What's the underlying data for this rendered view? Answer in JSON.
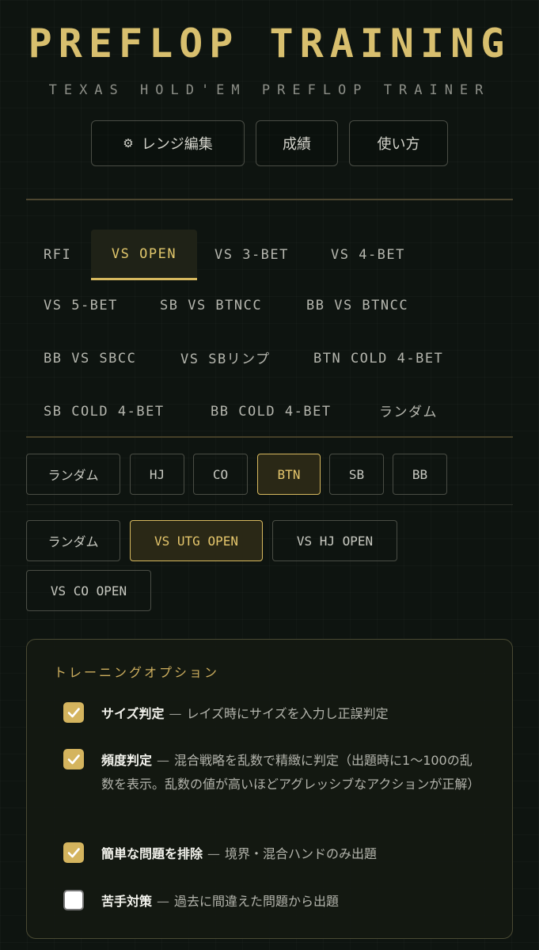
{
  "header": {
    "title": "PREFLOP TRAINING",
    "subtitle": "TEXAS HOLD'EM PREFLOP TRAINER"
  },
  "top_buttons": {
    "range_edit": "レンジ編集",
    "range_edit_icon": "gear-icon",
    "stats": "成績",
    "howto": "使い方"
  },
  "scenario_tabs": [
    "RFI",
    "VS OPEN",
    "VS 3-BET",
    "VS 4-BET",
    "VS 5-BET",
    "SB VS BTNCC",
    "BB VS BTNCC",
    "BB VS SBCC",
    "VS SBリンプ",
    "BTN COLD 4-BET",
    "SB COLD 4-BET",
    "BB COLD 4-BET",
    "ランダム"
  ],
  "active_scenario": "VS OPEN",
  "positions": [
    "ランダム",
    "HJ",
    "CO",
    "BTN",
    "SB",
    "BB"
  ],
  "active_position": "BTN",
  "opponents": [
    "ランダム",
    "VS UTG OPEN",
    "VS HJ OPEN",
    "VS CO OPEN"
  ],
  "active_opponent": "VS UTG OPEN",
  "training_options": {
    "title": "トレーニングオプション",
    "dash": "—",
    "items": [
      {
        "label": "サイズ判定",
        "desc": "レイズ時にサイズを入力し正誤判定",
        "checked": true
      },
      {
        "label": "頻度判定",
        "desc": "混合戦略を乱数で精緻に判定（出題時に1〜100の乱数を表示。乱数の値が高いほどアグレッシブなアクションが正解）",
        "checked": true
      },
      {
        "label": "簡単な問題を排除",
        "desc": "境界・混合ハンドのみ出題",
        "checked": true
      },
      {
        "label": "苦手対策",
        "desc": "過去に間違えた問題から出題",
        "checked": false
      }
    ]
  },
  "colors": {
    "accent_gold": "#d7b95f",
    "background": "#0e1410",
    "checkbox_on": "#d4b45e"
  }
}
